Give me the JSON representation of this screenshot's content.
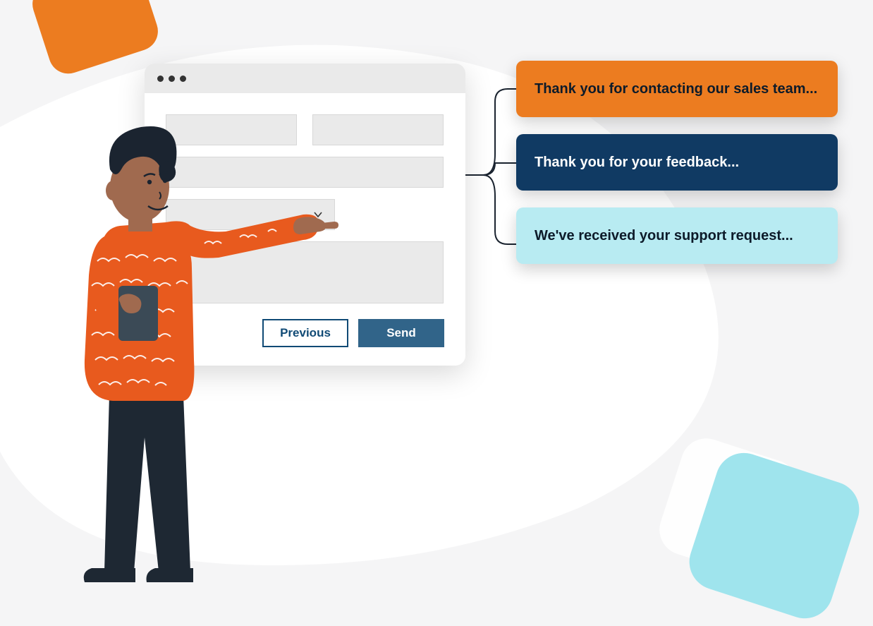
{
  "form": {
    "previous_label": "Previous",
    "send_label": "Send"
  },
  "responses": [
    {
      "text": "Thank you for contacting our sales team..."
    },
    {
      "text": "Thank you for your feedback..."
    },
    {
      "text": "We've received your support request..."
    }
  ],
  "colors": {
    "orange": "#EC7C20",
    "navy": "#103A63",
    "cyan": "#B8EBF2",
    "blue_btn": "#316489"
  }
}
